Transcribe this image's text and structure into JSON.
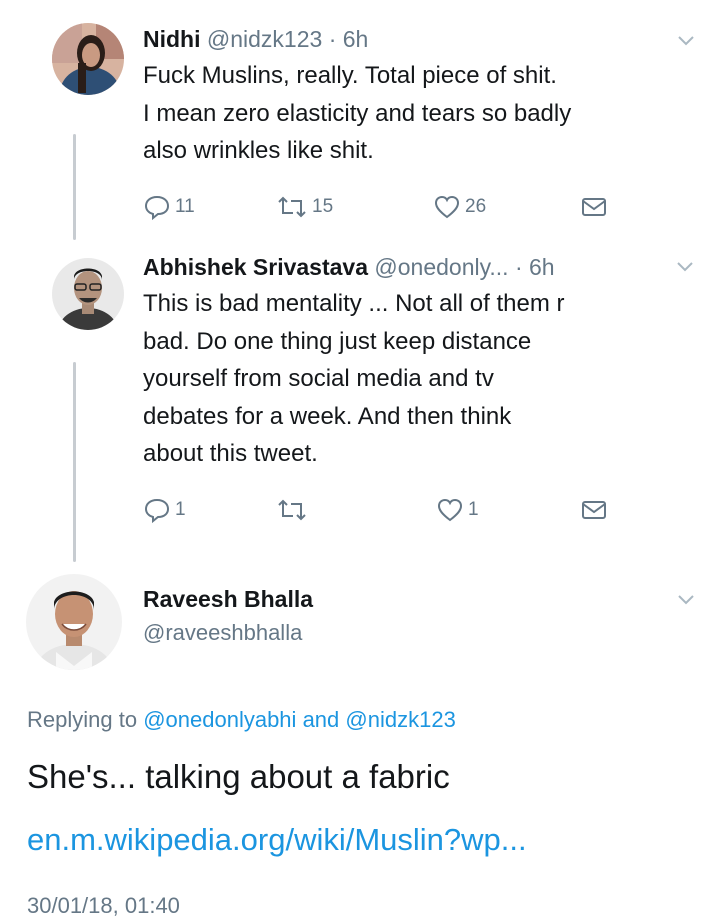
{
  "colors": {
    "text": "#14171a",
    "secondary": "#657786",
    "link": "#1b95e0",
    "thread_line": "#c7ccd1",
    "background": "#ffffff"
  },
  "icons": {
    "reply": "speech-bubble-icon",
    "retweet": "retweet-arrows-icon",
    "like": "heart-icon",
    "dm": "envelope-icon",
    "more": "chevron-down-icon"
  },
  "tweets": [
    {
      "name": "Nidhi",
      "handle": "@nidzk123",
      "time": "· 6h",
      "text": "Fuck Muslins, really. Total piece of shit.\nI mean zero elasticity and tears so badly\nalso wrinkles like shit.",
      "replies": "11",
      "retweets": "15",
      "likes": "26"
    },
    {
      "name": "Abhishek Srivastava",
      "handle": "@onedonly...",
      "time": "· 6h",
      "text": "This is bad mentality ... Not all of them r\nbad. Do one thing just keep distance\nyourself from social media and tv\ndebates for a week. And then think\nabout this tweet.",
      "replies": "1",
      "retweets": "",
      "likes": "1"
    }
  ],
  "main_tweet": {
    "name": "Raveesh Bhalla",
    "handle": "@raveeshbhalla",
    "replying_prefix": "Replying to",
    "mention_1": "@onedonlyabhi",
    "and_text": "and",
    "mention_2": "@nidzk123",
    "text": "She's... talking about a fabric",
    "link": "en.m.wikipedia.org/wiki/Muslin?wp...",
    "timestamp": "30/01/18, 01:40"
  }
}
